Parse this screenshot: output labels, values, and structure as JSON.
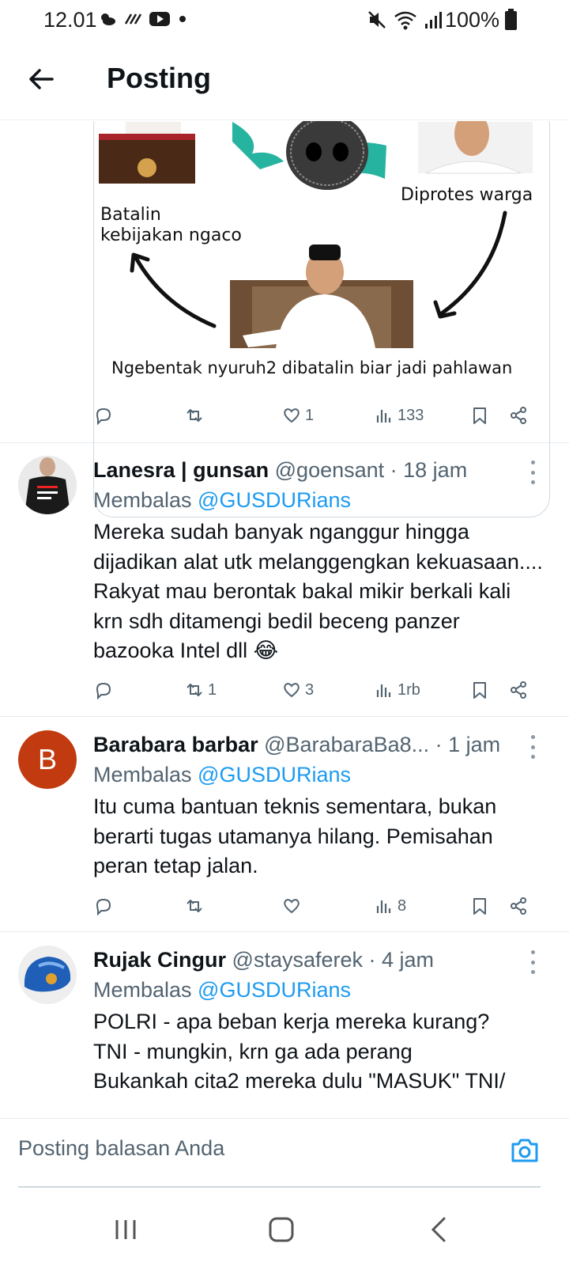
{
  "status_bar": {
    "time": "12.01",
    "battery": "100%"
  },
  "header": {
    "title": "Posting"
  },
  "meme": {
    "label_left": [
      "Batalin",
      "kebijakan ngaco"
    ],
    "label_right": "Diprotes warga",
    "label_bottom": "Ngebentak nyuruh2 dibatalin biar jadi pahlawan"
  },
  "main_post_actions": {
    "replies": "",
    "reposts": "",
    "likes": "1",
    "views": "133"
  },
  "replies": [
    {
      "name": "Lanesra | gunsan",
      "handle": "@goensant · 18 jam",
      "replying_prefix": "Membalas ",
      "replying_to": "@GUSDURians",
      "text": "Mereka sudah banyak nganggur hingga dijadikan alat utk melanggengkan kekuasaan.... Rakyat mau berontak bakal mikir berkali kali krn sdh ditamengi bedil beceng panzer bazooka Intel dll 😂",
      "replies": "",
      "reposts": "1",
      "likes": "3",
      "views": "1rb",
      "avatar_color": "#2a2a2a"
    },
    {
      "name": "Barabara barbar",
      "handle": "@BarabaraBa8... · 1 jam",
      "replying_prefix": "Membalas ",
      "replying_to": "@GUSDURians",
      "text": "Itu cuma bantuan teknis sementara, bukan berarti tugas utamanya hilang. Pemisahan peran tetap jalan.",
      "replies": "",
      "reposts": "",
      "likes": "",
      "views": "8",
      "avatar_letter": "B",
      "avatar_color": "#c23a0f"
    },
    {
      "name": "Rujak Cingur",
      "handle": "@staysaferek · 4 jam",
      "replying_prefix": "Membalas ",
      "replying_to": "@GUSDURians",
      "text": "POLRI - apa beban kerja mereka kurang?\nTNI - mungkin, krn ga ada perang\nBukankah cita2 mereka dulu \"MASUK\" TNI/",
      "avatar_color": "#1f5fb8"
    }
  ],
  "compose": {
    "placeholder": "Posting balasan Anda"
  },
  "colors": {
    "accent": "#1d9bf0",
    "muted": "#536471"
  }
}
